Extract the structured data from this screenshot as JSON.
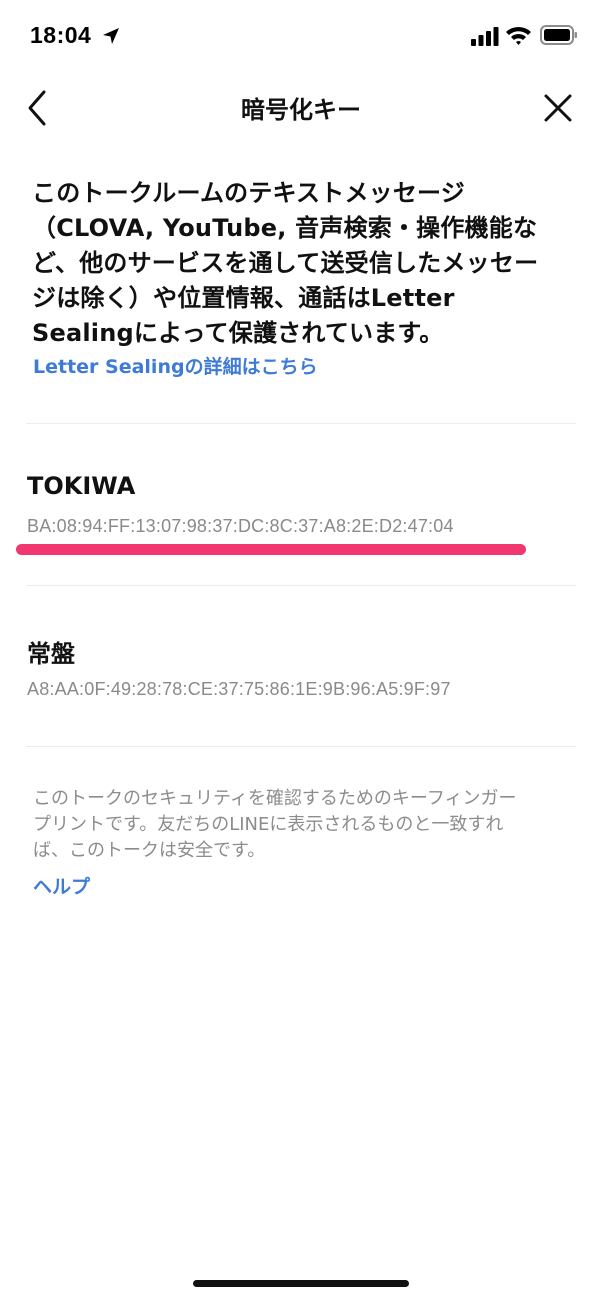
{
  "status_bar": {
    "time": "18:04",
    "icons": [
      "location-arrow-icon",
      "cellular-signal-icon",
      "wifi-icon",
      "battery-icon"
    ]
  },
  "header": {
    "title": "暗号化キー",
    "back_icon": "chevron-left-icon",
    "close_icon": "close-icon"
  },
  "intro": {
    "lines": [
      "このトークルームのテキストメッセージ",
      "（CLOVA, YouTube, 音声検索・操作機能な",
      "ど、他のサービスを通して送受信したメッセー",
      "ジは除く）や位置情報、通話はLetter",
      "Sealingによって保護されています。"
    ],
    "details_link": "Letter Sealingの詳細はこちら"
  },
  "keys": [
    {
      "name": "TOKIWA",
      "fingerprint": "BA:08:94:FF:13:07:98:37:DC:8C:37:A8:2E:D2:47:04",
      "highlighted": true
    },
    {
      "name": "常盤",
      "fingerprint": "A8:AA:0F:49:28:78:CE:37:75:86:1E:9B:96:A5:9F:97",
      "highlighted": false
    }
  ],
  "footer": {
    "lines": [
      "このトークのセキュリティを確認するためのキーフィンガー",
      "プリントです。友だちのLINEに表示されるものと一致すれ",
      "ば、このトークは安全です。"
    ],
    "help_link": "ヘルプ"
  },
  "colors": {
    "link": "#3d7bd6",
    "highlight": "#f0376f",
    "secondary_text": "#8a8a8a"
  }
}
